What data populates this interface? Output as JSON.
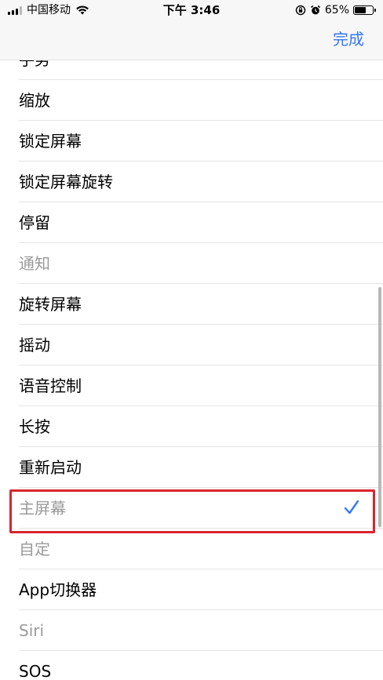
{
  "status_bar": {
    "carrier": "中国移动",
    "time": "下午 3:46",
    "battery_percent": "65%",
    "battery_level": 0.65,
    "icons": [
      "signal-icon",
      "wifi-icon",
      "orientation-lock-icon",
      "alarm-icon",
      "battery-icon"
    ]
  },
  "nav": {
    "done_label": "完成"
  },
  "list": {
    "items": [
      {
        "label": "手势",
        "dim": false
      },
      {
        "label": "缩放",
        "dim": false
      },
      {
        "label": "锁定屏幕",
        "dim": false
      },
      {
        "label": "锁定屏幕旋转",
        "dim": false
      },
      {
        "label": "停留",
        "dim": false
      },
      {
        "label": "通知",
        "dim": true
      },
      {
        "label": "旋转屏幕",
        "dim": false
      },
      {
        "label": "摇动",
        "dim": false
      },
      {
        "label": "语音控制",
        "dim": false
      },
      {
        "label": "长按",
        "dim": false
      },
      {
        "label": "重新启动",
        "dim": false
      },
      {
        "label": "主屏幕",
        "dim": true,
        "selected": true
      },
      {
        "label": "自定",
        "dim": true
      },
      {
        "label": "App切换器",
        "dim": false
      },
      {
        "label": "Siri",
        "dim": true
      },
      {
        "label": "SOS",
        "dim": false
      }
    ]
  },
  "colors": {
    "accent": "#3478f6",
    "highlight_border": "#d9252d",
    "dim_text": "#9a9a9a"
  }
}
